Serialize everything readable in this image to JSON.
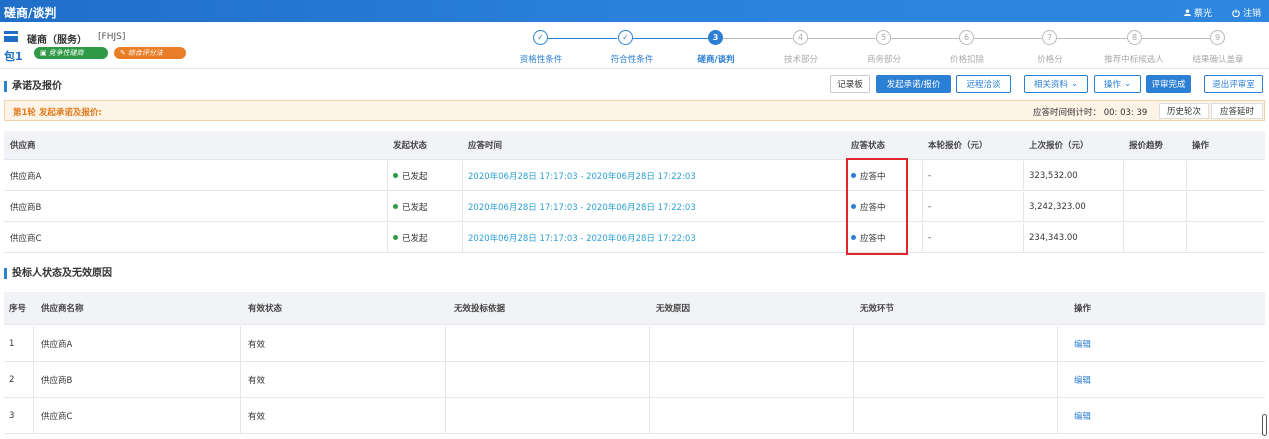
{
  "app": {
    "title": "磋商/谈判",
    "user_name": "蔡光",
    "logout_label": "注销",
    "accent_color": "#2b7fd4"
  },
  "package": {
    "name": "磋商（服务）",
    "code": "[FHJS]",
    "number": "包1",
    "tags": [
      "竞争性磋商",
      "综合评分法"
    ]
  },
  "steps": [
    {
      "marker": "✓",
      "label": "资格性条件",
      "state": "done"
    },
    {
      "marker": "✓",
      "label": "符合性条件",
      "state": "done"
    },
    {
      "marker": "3",
      "label": "磋商/谈判",
      "state": "active"
    },
    {
      "marker": "4",
      "label": "技术部分",
      "state": "todo"
    },
    {
      "marker": "5",
      "label": "商务部分",
      "state": "todo"
    },
    {
      "marker": "6",
      "label": "价格扣除",
      "state": "todo"
    },
    {
      "marker": "7",
      "label": "价格分",
      "state": "todo"
    },
    {
      "marker": "8",
      "label": "推荐中标候选人",
      "state": "todo"
    },
    {
      "marker": "9",
      "label": "结果确认盖章",
      "state": "todo"
    }
  ],
  "quote_section": {
    "title": "承诺及报价",
    "buttons": {
      "record": "记录板",
      "initiate": "发起承诺/报价",
      "remote": "远程洽谈",
      "materials": "相关资料",
      "operate": "操作",
      "finish": "评审完成",
      "exit": "退出评审室"
    },
    "round_text": "第1轮 发起承诺及报价:",
    "countdown_label": "应答时间倒计时：",
    "countdown_value": "00: 03: 39",
    "history_btn": "历史轮次",
    "delay_btn": "应答延时",
    "columns": [
      "供应商",
      "发起状态",
      "应答时间",
      "应答状态",
      "本轮报价（元）",
      "上次报价（元）",
      "报价趋势",
      "操作"
    ],
    "rows": [
      {
        "supplier": "供应商A",
        "status": "已发起",
        "time": "2020年06月28日 17:17:03 - 2020年06月28日 17:22:03",
        "answer": "应答中",
        "current": "-",
        "last": "323,532.00"
      },
      {
        "supplier": "供应商B",
        "status": "已发起",
        "time": "2020年06月28日 17:17:03 - 2020年06月28日 17:22:03",
        "answer": "应答中",
        "current": "-",
        "last": "3,242,323.00"
      },
      {
        "supplier": "供应商C",
        "status": "已发起",
        "time": "2020年06月28日 17:17:03 - 2020年06月28日 17:22:03",
        "answer": "应答中",
        "current": "-",
        "last": "234,343.00"
      }
    ]
  },
  "bidder_section": {
    "title": "投标人状态及无效原因",
    "columns": [
      "序号",
      "供应商名称",
      "有效状态",
      "无效投标依据",
      "无效原因",
      "无效环节",
      "操作"
    ],
    "rows": [
      {
        "no": "1",
        "supplier": "供应商A",
        "validity": "有效",
        "basis": "",
        "reason": "",
        "stage": "",
        "action": "编辑"
      },
      {
        "no": "2",
        "supplier": "供应商B",
        "validity": "有效",
        "basis": "",
        "reason": "",
        "stage": "",
        "action": "编辑"
      },
      {
        "no": "3",
        "supplier": "供应商C",
        "validity": "有效",
        "basis": "",
        "reason": "",
        "stage": "",
        "action": "编辑"
      }
    ]
  }
}
